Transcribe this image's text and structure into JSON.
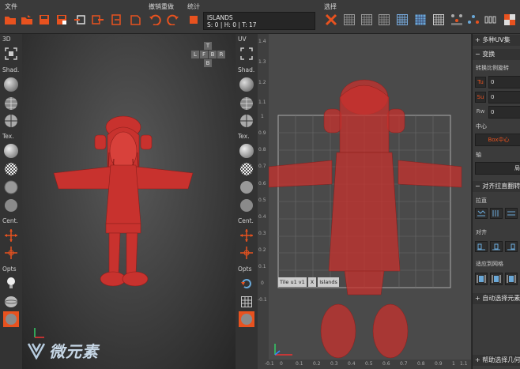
{
  "menu": {
    "file": "文件",
    "undo_redo": "撤销重做",
    "stats": "统计",
    "select": "选择"
  },
  "islands": {
    "title": "ISLANDS",
    "stats": "S: 0 | H: 0 | T: 17"
  },
  "left_tools": {
    "view": "3D",
    "shading": "Shad.",
    "texture": "Tex.",
    "center": "Cent.",
    "options": "Opts"
  },
  "uv_tools": {
    "view": "UV",
    "shading": "Shad.",
    "texture": "Tex.",
    "center": "Cent.",
    "options": "Opts"
  },
  "navcube": {
    "top": "T",
    "left": "L",
    "front": "F",
    "back": "B",
    "right": "R",
    "bottom": "B"
  },
  "uv_grid": {
    "tile_label": "Tile u1 v1",
    "tile_close": "X",
    "tile_mode": "Islands",
    "y_ticks": [
      "1.4",
      "1.3",
      "1.2",
      "1.1",
      "1",
      "0.9",
      "0.8",
      "0.7",
      "0.6",
      "0.5",
      "0.4",
      "0.3",
      "0.2",
      "0.1",
      "0",
      "-0.1"
    ],
    "x_ticks": [
      "-0.1",
      "0",
      "0.1",
      "0.2",
      "0.3",
      "0.4",
      "0.5",
      "0.6",
      "0.7",
      "0.8",
      "0.9",
      "1",
      "1.1"
    ]
  },
  "right_panel": {
    "multi_uv": "多种UV集",
    "transform": "变换",
    "scale_rotate": "转换比例旋转",
    "tu": "Tu",
    "tu_value": "0",
    "su": "Su",
    "su_value": "0",
    "rw": "Rw",
    "rw_value": "0",
    "center": "中心",
    "box_center": "Box中心",
    "axis": "轴",
    "axis_value": "局",
    "align_section": "对齐拉直翻转",
    "straighten": "拉直",
    "align": "对齐",
    "fit_grid": "适应到网格",
    "auto_select": "自动选择元素",
    "help_select": "帮助选择几何"
  },
  "watermark": "微元素",
  "colors": {
    "accent": "#e8521f",
    "model": "#c8322e",
    "bg_dark": "#2b2b2b",
    "toolbar": "#3a3a3a"
  }
}
